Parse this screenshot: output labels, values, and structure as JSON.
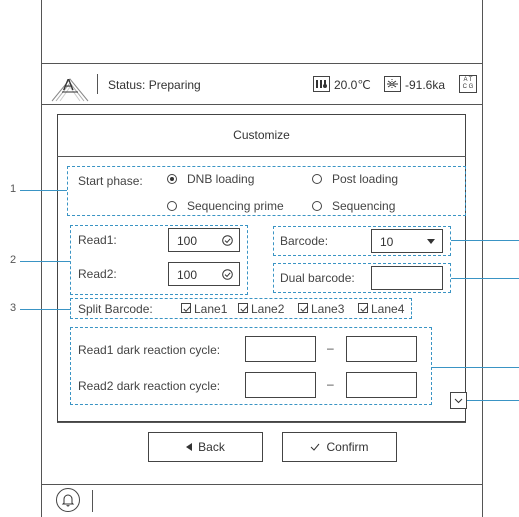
{
  "status_bar": {
    "status_text": "Status: Preparing",
    "temperature": "20.0℃",
    "pressure": "-91.6ka",
    "logo_letter": "A",
    "atcg_top": "A T",
    "atcg_bottom": "C G"
  },
  "panel": {
    "title": "Customize"
  },
  "start_phase": {
    "label": "Start phase:",
    "options": [
      {
        "label": "DNB loading",
        "selected": true
      },
      {
        "label": "Post loading",
        "selected": false
      },
      {
        "label": "Sequencing prime",
        "selected": false
      },
      {
        "label": "Sequencing",
        "selected": false
      }
    ]
  },
  "reads": {
    "read1_label": "Read1:",
    "read1_value": "100",
    "read2_label": "Read2:",
    "read2_value": "100"
  },
  "barcode": {
    "label": "Barcode:",
    "value": "10",
    "dual_label": "Dual barcode:",
    "dual_value": ""
  },
  "split_barcode": {
    "label": "Split Barcode:",
    "lanes": [
      {
        "label": "Lane1",
        "checked": true
      },
      {
        "label": "Lane2",
        "checked": true
      },
      {
        "label": "Lane3",
        "checked": true
      },
      {
        "label": "Lane4",
        "checked": true
      }
    ]
  },
  "dark_reaction": {
    "read1_label": "Read1 dark reaction cycle:",
    "read2_label": "Read2 dark reaction cycle:",
    "separator": "–",
    "read1_from": "",
    "read1_to": "",
    "read2_from": "",
    "read2_to": ""
  },
  "buttons": {
    "back": "Back",
    "confirm": "Confirm"
  },
  "callouts": {
    "c1": "1",
    "c2": "2",
    "c3": "3"
  },
  "icons": [
    "logo-icon",
    "thermometer-icon",
    "pressure-icon",
    "atcg-icon",
    "chevron-down-icon",
    "back-arrow-icon",
    "checkmark-icon",
    "bell-icon"
  ]
}
